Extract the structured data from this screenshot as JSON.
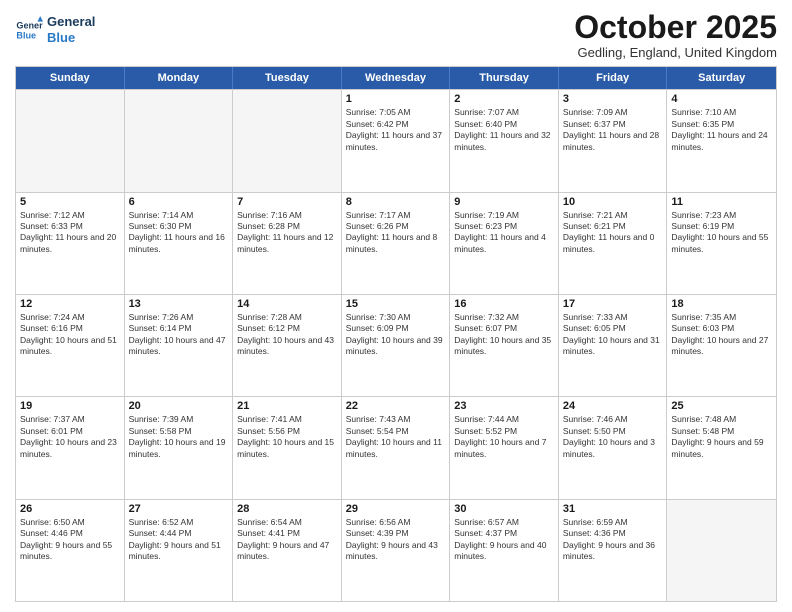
{
  "header": {
    "logo_line1": "General",
    "logo_line2": "Blue",
    "month_title": "October 2025",
    "location": "Gedling, England, United Kingdom"
  },
  "day_headers": [
    "Sunday",
    "Monday",
    "Tuesday",
    "Wednesday",
    "Thursday",
    "Friday",
    "Saturday"
  ],
  "weeks": [
    [
      {
        "date": "",
        "empty": true
      },
      {
        "date": "",
        "empty": true
      },
      {
        "date": "",
        "empty": true
      },
      {
        "date": "1",
        "sunrise": "7:05 AM",
        "sunset": "6:42 PM",
        "daylight": "11 hours and 37 minutes."
      },
      {
        "date": "2",
        "sunrise": "7:07 AM",
        "sunset": "6:40 PM",
        "daylight": "11 hours and 32 minutes."
      },
      {
        "date": "3",
        "sunrise": "7:09 AM",
        "sunset": "6:37 PM",
        "daylight": "11 hours and 28 minutes."
      },
      {
        "date": "4",
        "sunrise": "7:10 AM",
        "sunset": "6:35 PM",
        "daylight": "11 hours and 24 minutes."
      }
    ],
    [
      {
        "date": "5",
        "sunrise": "7:12 AM",
        "sunset": "6:33 PM",
        "daylight": "11 hours and 20 minutes."
      },
      {
        "date": "6",
        "sunrise": "7:14 AM",
        "sunset": "6:30 PM",
        "daylight": "11 hours and 16 minutes."
      },
      {
        "date": "7",
        "sunrise": "7:16 AM",
        "sunset": "6:28 PM",
        "daylight": "11 hours and 12 minutes."
      },
      {
        "date": "8",
        "sunrise": "7:17 AM",
        "sunset": "6:26 PM",
        "daylight": "11 hours and 8 minutes."
      },
      {
        "date": "9",
        "sunrise": "7:19 AM",
        "sunset": "6:23 PM",
        "daylight": "11 hours and 4 minutes."
      },
      {
        "date": "10",
        "sunrise": "7:21 AM",
        "sunset": "6:21 PM",
        "daylight": "11 hours and 0 minutes."
      },
      {
        "date": "11",
        "sunrise": "7:23 AM",
        "sunset": "6:19 PM",
        "daylight": "10 hours and 55 minutes."
      }
    ],
    [
      {
        "date": "12",
        "sunrise": "7:24 AM",
        "sunset": "6:16 PM",
        "daylight": "10 hours and 51 minutes."
      },
      {
        "date": "13",
        "sunrise": "7:26 AM",
        "sunset": "6:14 PM",
        "daylight": "10 hours and 47 minutes."
      },
      {
        "date": "14",
        "sunrise": "7:28 AM",
        "sunset": "6:12 PM",
        "daylight": "10 hours and 43 minutes."
      },
      {
        "date": "15",
        "sunrise": "7:30 AM",
        "sunset": "6:09 PM",
        "daylight": "10 hours and 39 minutes."
      },
      {
        "date": "16",
        "sunrise": "7:32 AM",
        "sunset": "6:07 PM",
        "daylight": "10 hours and 35 minutes."
      },
      {
        "date": "17",
        "sunrise": "7:33 AM",
        "sunset": "6:05 PM",
        "daylight": "10 hours and 31 minutes."
      },
      {
        "date": "18",
        "sunrise": "7:35 AM",
        "sunset": "6:03 PM",
        "daylight": "10 hours and 27 minutes."
      }
    ],
    [
      {
        "date": "19",
        "sunrise": "7:37 AM",
        "sunset": "6:01 PM",
        "daylight": "10 hours and 23 minutes."
      },
      {
        "date": "20",
        "sunrise": "7:39 AM",
        "sunset": "5:58 PM",
        "daylight": "10 hours and 19 minutes."
      },
      {
        "date": "21",
        "sunrise": "7:41 AM",
        "sunset": "5:56 PM",
        "daylight": "10 hours and 15 minutes."
      },
      {
        "date": "22",
        "sunrise": "7:43 AM",
        "sunset": "5:54 PM",
        "daylight": "10 hours and 11 minutes."
      },
      {
        "date": "23",
        "sunrise": "7:44 AM",
        "sunset": "5:52 PM",
        "daylight": "10 hours and 7 minutes."
      },
      {
        "date": "24",
        "sunrise": "7:46 AM",
        "sunset": "5:50 PM",
        "daylight": "10 hours and 3 minutes."
      },
      {
        "date": "25",
        "sunrise": "7:48 AM",
        "sunset": "5:48 PM",
        "daylight": "9 hours and 59 minutes."
      }
    ],
    [
      {
        "date": "26",
        "sunrise": "6:50 AM",
        "sunset": "4:46 PM",
        "daylight": "9 hours and 55 minutes."
      },
      {
        "date": "27",
        "sunrise": "6:52 AM",
        "sunset": "4:44 PM",
        "daylight": "9 hours and 51 minutes."
      },
      {
        "date": "28",
        "sunrise": "6:54 AM",
        "sunset": "4:41 PM",
        "daylight": "9 hours and 47 minutes."
      },
      {
        "date": "29",
        "sunrise": "6:56 AM",
        "sunset": "4:39 PM",
        "daylight": "9 hours and 43 minutes."
      },
      {
        "date": "30",
        "sunrise": "6:57 AM",
        "sunset": "4:37 PM",
        "daylight": "9 hours and 40 minutes."
      },
      {
        "date": "31",
        "sunrise": "6:59 AM",
        "sunset": "4:36 PM",
        "daylight": "9 hours and 36 minutes."
      },
      {
        "date": "",
        "empty": true
      }
    ]
  ]
}
